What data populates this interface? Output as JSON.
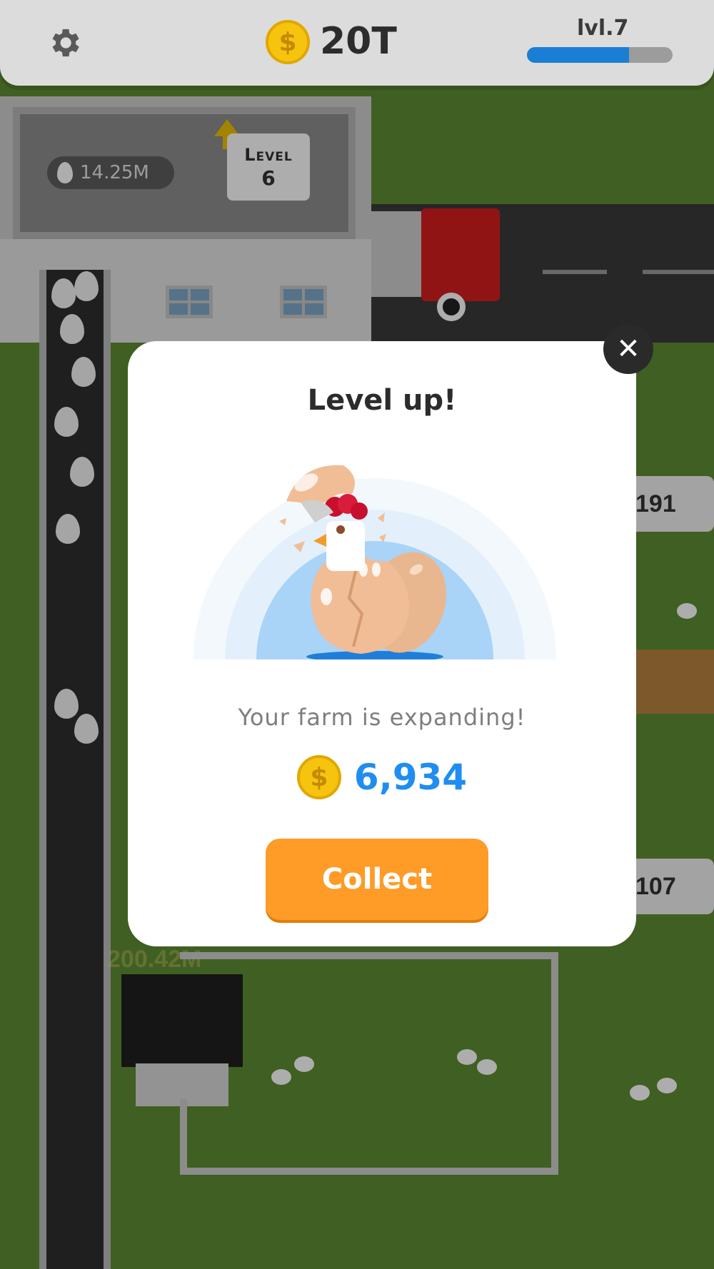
{
  "hud": {
    "currency": "20T",
    "level": "lvl.7",
    "level_progress": 0.7,
    "icons": {
      "settings": "gear-icon",
      "currency": "coin-icon"
    }
  },
  "world": {
    "egg_storage": "14.25M",
    "building_level_label": "Level",
    "building_level_value": "6",
    "side_value_1": "191",
    "side_value_2": "107",
    "ghost_value": "200.42M"
  },
  "modal": {
    "title": "Level up!",
    "subtitle": "Your farm is expanding!",
    "reward_amount": "6,934",
    "collect_label": "Collect",
    "close_label": "✕"
  },
  "colors": {
    "accent_orange": "#ff9b27",
    "reward_blue": "#1f8ef0",
    "progress_blue": "#1a7fd4",
    "coin_gold": "#f6c40f"
  }
}
